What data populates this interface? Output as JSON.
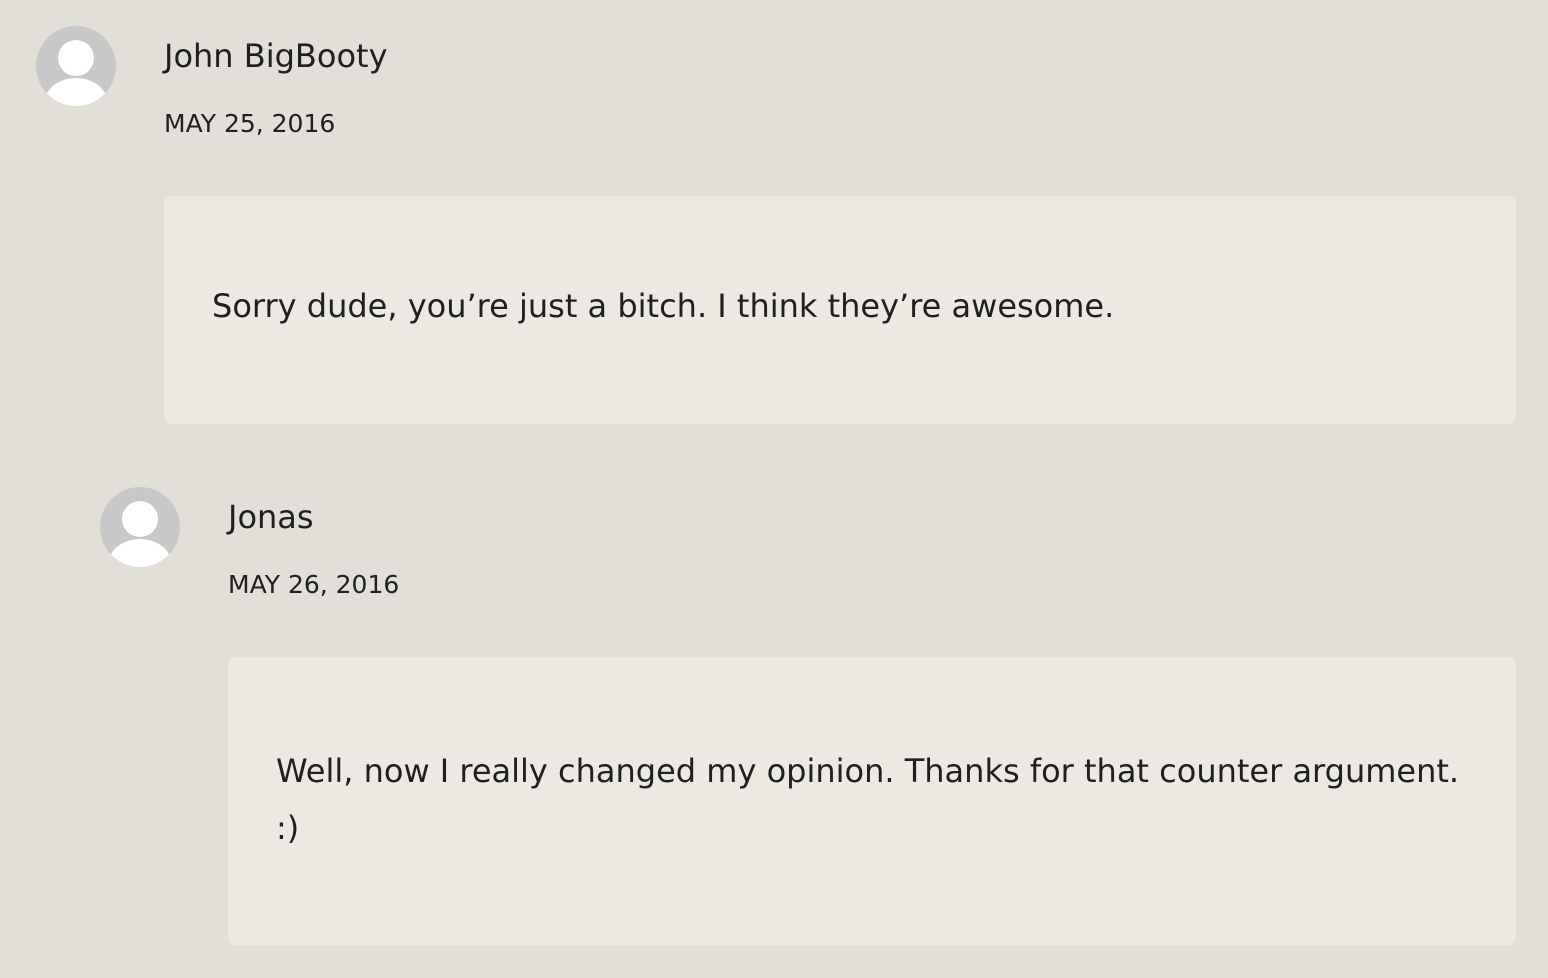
{
  "comments": [
    {
      "author": "John BigBooty",
      "date": "MAY 25, 2016",
      "text": "Sorry dude, you’re just a bitch. I think they’re awesome.",
      "avatar_icon": "default-avatar-icon"
    },
    {
      "author": "Jonas",
      "date": "MAY 26, 2016",
      "text": "Well, now I really changed my opinion. Thanks for that counter argument. :)",
      "avatar_icon": "default-avatar-icon"
    }
  ],
  "colors": {
    "page_background": "#e2dfd9",
    "bubble_background": "#ece9e3",
    "avatar_background": "#c8c8c8",
    "text": "#1f1f1f"
  }
}
